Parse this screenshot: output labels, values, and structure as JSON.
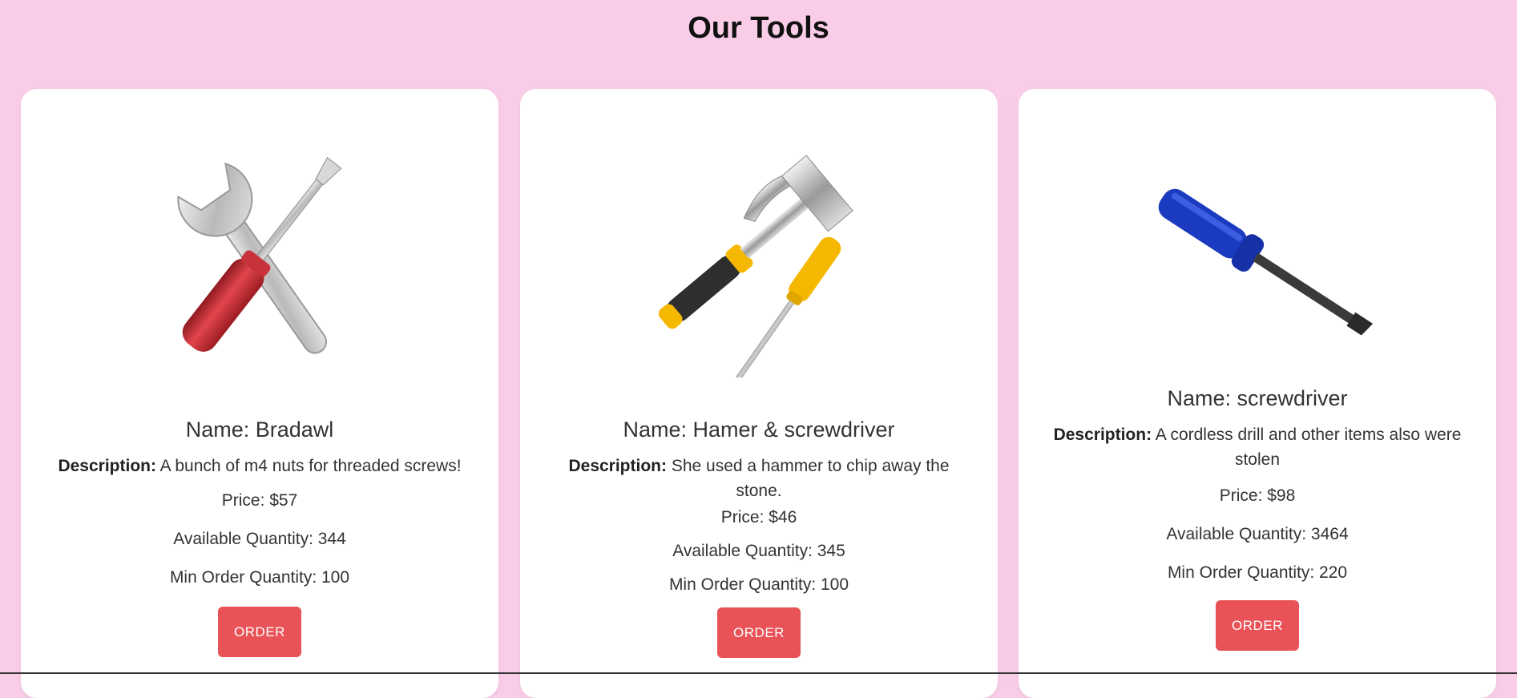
{
  "page": {
    "title": "Our Tools"
  },
  "labels": {
    "description": "Description:"
  },
  "cards": [
    {
      "image_icon": "wrench-and-screwdriver-icon",
      "name": "Name: Bradawl",
      "description": "A bunch of m4 nuts for threaded screws!",
      "price": "Price: $57",
      "available": "Available Quantity: 344",
      "min_order": "Min Order Quantity: 100",
      "button": "ORDER"
    },
    {
      "image_icon": "hammer-and-screwdriver-icon",
      "name": "Name: Hamer & screwdriver",
      "description": "She used a hammer to chip away the stone.",
      "price": "Price: $46",
      "available": "Available Quantity: 345",
      "min_order": "Min Order Quantity: 100",
      "button": "ORDER"
    },
    {
      "image_icon": "screwdriver-icon",
      "name": "Name: screwdriver",
      "description": "A cordless drill and other items also were stolen",
      "price": "Price: $98",
      "available": "Available Quantity: 3464",
      "min_order": "Min Order Quantity: 220",
      "button": "ORDER"
    }
  ],
  "colors": {
    "background": "#f9cde8",
    "button": "#e95257",
    "card": "#ffffff"
  }
}
